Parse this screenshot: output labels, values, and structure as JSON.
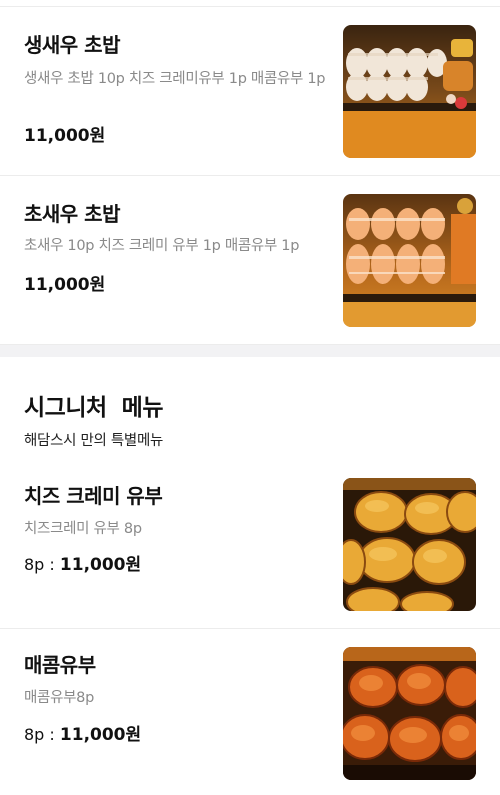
{
  "menu_top": [
    {
      "name": "생새우 초밥",
      "description": "생새우 초밥 10p  치즈 크레미유부 1p  매콤유부 1p",
      "price": "11,000원",
      "image": "shrimp-sushi-photo"
    },
    {
      "name": "초새우 초밥",
      "description": "초새우 10p 치즈 크레미 유부 1p 매콤유부 1p",
      "price": "11,000원",
      "image": "cooked-shrimp-sushi-photo"
    }
  ],
  "signature": {
    "title": "시그니처  메뉴",
    "subtitle": "해담스시 만의 특별메뉴",
    "items": [
      {
        "name": "치즈 크레미 유부",
        "description": "치즈크레미 유부 8p",
        "qty": "8p : ",
        "price": "11,000원",
        "image": "cheese-cremi-yubu-photo"
      },
      {
        "name": "매콤유부",
        "description": "매콤유부8p",
        "qty": "8p : ",
        "price": "11,000원",
        "image": "spicy-yubu-photo"
      }
    ]
  },
  "colors": {
    "text_primary": "#111111",
    "text_secondary": "#8a8a8a",
    "divider": "#ececec",
    "section_gap": "#f2f2f4"
  }
}
